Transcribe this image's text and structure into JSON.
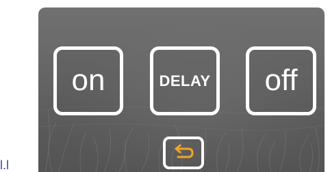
{
  "colors": {
    "button_border": "#ffffff",
    "button_text": "#ffffff",
    "back_arrow": "#f5a623",
    "corner_text": "#3b3fbf",
    "panel_background": "#636363"
  },
  "controls": {
    "on_label": "on",
    "delay_label": "DELAY",
    "off_label": "off",
    "back_icon": "return-arrow-icon"
  },
  "corner_text": "l.l"
}
